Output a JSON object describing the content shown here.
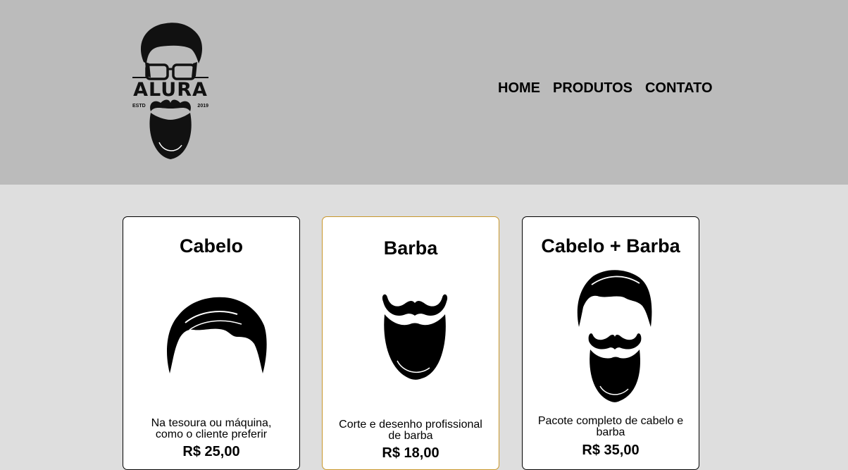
{
  "logo": {
    "text": "ALURA",
    "estd": "ESTD",
    "year": "2019"
  },
  "nav": {
    "items": [
      {
        "label": "HOME"
      },
      {
        "label": "PRODUTOS"
      },
      {
        "label": "CONTATO"
      }
    ]
  },
  "products": [
    {
      "title": "Cabelo",
      "description": "Na tesoura ou máquina, como o cliente preferir",
      "price": "R$ 25,00",
      "icon": "hair-icon"
    },
    {
      "title": "Barba",
      "description": "Corte e desenho profissional de barba",
      "price": "R$ 18,00",
      "icon": "beard-icon"
    },
    {
      "title": "Cabelo + Barba",
      "description": "Pacote completo de cabelo e barba",
      "price": "R$ 35,00",
      "icon": "hair-and-beard-icon"
    }
  ],
  "colors": {
    "header_bg": "#bbbbbb",
    "page_bg": "#dedede",
    "featured_border": "#c8962a"
  }
}
